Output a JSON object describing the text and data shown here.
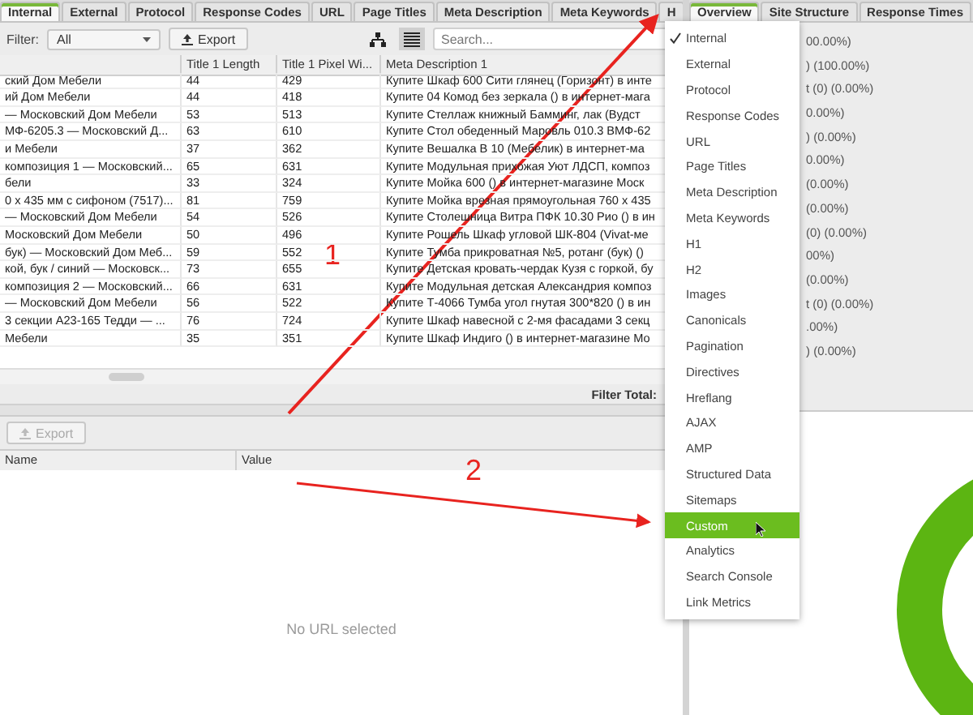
{
  "left_tabs": [
    {
      "label": "Internal",
      "selected": true
    },
    {
      "label": "External",
      "selected": false
    },
    {
      "label": "Protocol",
      "selected": false
    },
    {
      "label": "Response Codes",
      "selected": false
    },
    {
      "label": "URL",
      "selected": false
    },
    {
      "label": "Page Titles",
      "selected": false
    },
    {
      "label": "Meta Description",
      "selected": false
    },
    {
      "label": "Meta Keywords",
      "selected": false
    },
    {
      "label": "H",
      "selected": false
    }
  ],
  "filter": {
    "label": "Filter:",
    "value": "All"
  },
  "export_button": "Export",
  "view_modes": [
    {
      "kind": "tree",
      "selected": false
    },
    {
      "kind": "list",
      "selected": true
    }
  ],
  "search": {
    "placeholder": "Search..."
  },
  "table": {
    "columns": [
      "",
      "Title 1 Length",
      "Title 1 Pixel Wi...",
      "Meta Description 1"
    ],
    "rows": [
      [
        "ский Дом Мебели",
        "44",
        "429",
        "Купите  Шкаф 600 Сити глянец (Горизонт) в инте"
      ],
      [
        "ий Дом Мебели",
        "44",
        "418",
        "Купите 04 Комод без зеркала () в интернет-мага"
      ],
      [
        "— Московский Дом Мебели",
        "53",
        "513",
        "Купите Стеллаж книжный Бамминг, лак (Вудст"
      ],
      [
        "МФ-6205.3 — Московский Д...",
        "63",
        "610",
        "Купите Стол обеденный Маровль 010.3 ВМФ-62"
      ],
      [
        "и Мебели",
        "37",
        "362",
        "Купите Вешалка В 10 (Мебелик) в интернет-ма"
      ],
      [
        "композиция 1 — Московский...",
        "65",
        "631",
        "Купите Модульная прихожая Уют ЛДСП, композ"
      ],
      [
        "бели",
        "33",
        "324",
        "Купите Мойка 600 () в интернет-магазине Моск"
      ],
      [
        "0 х 435 мм с сифоном (7517)...",
        "81",
        "759",
        "Купите Мойка врезная прямоугольная 760 х 435"
      ],
      [
        "— Московский Дом Мебели",
        "54",
        "526",
        "Купите Столешница Витра ПФК 10.30 Рио () в ин"
      ],
      [
        "Московский Дом Мебели",
        "50",
        "496",
        "Купите Рошель Шкаф угловой ШК-804 (Vivat-ме"
      ],
      [
        "бук) — Московский Дом Меб...",
        "59",
        "552",
        "Купите Тумба прикроватная №5, ротанг (бук) ()"
      ],
      [
        "кой, бук / синий — Московск...",
        "73",
        "655",
        "Купите Детская кровать-чердак Кузя с горкой, бу"
      ],
      [
        "композиция 2 — Московский...",
        "66",
        "631",
        "Купите Модульная детская Александрия композ"
      ],
      [
        "— Московский Дом Мебели",
        "56",
        "522",
        "Купите Т-4066 Тумба угол гнутая 300*820 () в ин"
      ],
      [
        "3 секции А23-165 Тедди — ...",
        "76",
        "724",
        "Купите Шкаф навесной с 2-мя фасадами 3 секц"
      ],
      [
        "Мебели",
        "35",
        "351",
        "Купите Шкаф Индиго () в интернет-магазине Мо"
      ]
    ]
  },
  "filter_total": "Filter Total:",
  "details": {
    "export_button": "Export",
    "export_disabled": true,
    "columns": [
      "Name",
      "Value"
    ],
    "empty_text": "No URL selected"
  },
  "right_tabs": [
    {
      "label": "Overview",
      "selected": true
    },
    {
      "label": "Site Structure",
      "selected": false
    },
    {
      "label": "Response Times",
      "selected": false
    }
  ],
  "overview_rows": [
    "00.00%)",
    ") (100.00%)",
    "t (0) (0.00%)",
    "0.00%)",
    ") (0.00%)",
    "0.00%)",
    "(0.00%)",
    "(0.00%)",
    "(0) (0.00%)",
    "00%)",
    "(0.00%)",
    "t (0) (0.00%)",
    ".00%)",
    ") (0.00%)"
  ],
  "dropdown_menu": [
    {
      "label": "Internal",
      "checked": true,
      "hovered": false
    },
    {
      "label": "External",
      "checked": false,
      "hovered": false
    },
    {
      "label": "Protocol",
      "checked": false,
      "hovered": false
    },
    {
      "label": "Response Codes",
      "checked": false,
      "hovered": false
    },
    {
      "label": "URL",
      "checked": false,
      "hovered": false
    },
    {
      "label": "Page Titles",
      "checked": false,
      "hovered": false
    },
    {
      "label": "Meta Description",
      "checked": false,
      "hovered": false
    },
    {
      "label": "Meta Keywords",
      "checked": false,
      "hovered": false
    },
    {
      "label": "H1",
      "checked": false,
      "hovered": false
    },
    {
      "label": "H2",
      "checked": false,
      "hovered": false
    },
    {
      "label": "Images",
      "checked": false,
      "hovered": false
    },
    {
      "label": "Canonicals",
      "checked": false,
      "hovered": false
    },
    {
      "label": "Pagination",
      "checked": false,
      "hovered": false
    },
    {
      "label": "Directives",
      "checked": false,
      "hovered": false
    },
    {
      "label": "Hreflang",
      "checked": false,
      "hovered": false
    },
    {
      "label": "AJAX",
      "checked": false,
      "hovered": false
    },
    {
      "label": "AMP",
      "checked": false,
      "hovered": false
    },
    {
      "label": "Structured Data",
      "checked": false,
      "hovered": false
    },
    {
      "label": "Sitemaps",
      "checked": false,
      "hovered": false
    },
    {
      "label": "Custom",
      "checked": false,
      "hovered": true
    },
    {
      "label": "Analytics",
      "checked": false,
      "hovered": false
    },
    {
      "label": "Search Console",
      "checked": false,
      "hovered": false
    },
    {
      "label": "Link Metrics",
      "checked": false,
      "hovered": false
    }
  ],
  "annotations": [
    {
      "label": "1"
    },
    {
      "label": "2"
    }
  ]
}
